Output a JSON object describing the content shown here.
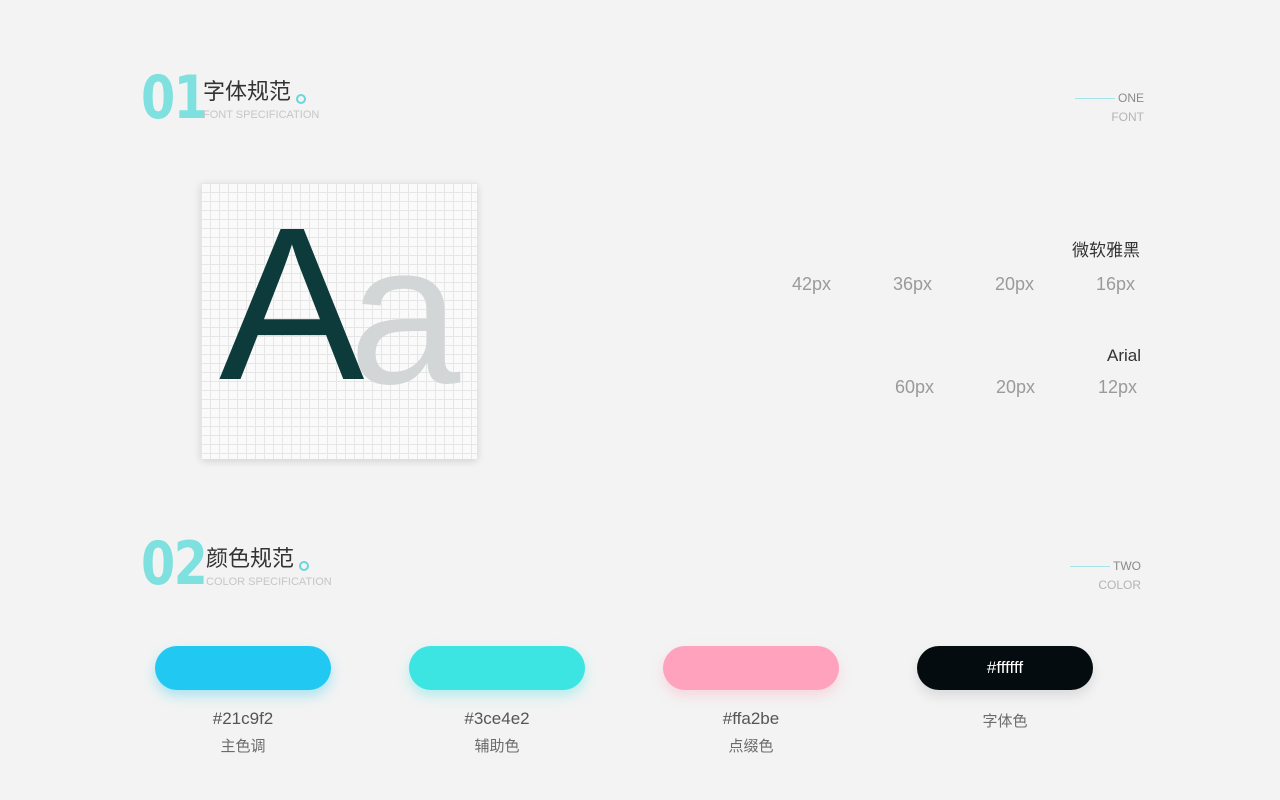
{
  "section1": {
    "number": "01",
    "title": "字体规范",
    "subtitle": "FONT SPECIFICATION",
    "tag_top": "ONE",
    "tag_bottom": "FONT"
  },
  "specimen": {
    "upper": "A",
    "lower": "a"
  },
  "fonts": [
    {
      "name": "微软雅黑",
      "sizes": [
        "42px",
        "36px",
        "20px",
        "16px"
      ]
    },
    {
      "name": "Arial",
      "sizes": [
        "60px",
        "20px",
        "12px"
      ]
    }
  ],
  "section2": {
    "number": "02",
    "title": "颜色规范",
    "subtitle": "COLOR SPECIFICATION",
    "tag_top": "TWO",
    "tag_bottom": "COLOR"
  },
  "colors": [
    {
      "hex": "#21c9f2",
      "name": "主色调",
      "label": "",
      "swatch": "#21c9f2",
      "shadow": "rgba(33,201,242,0.35)"
    },
    {
      "hex": "#3ce4e2",
      "name": "辅助色",
      "label": "",
      "swatch": "#3ce4e2",
      "shadow": "rgba(60,228,226,0.35)"
    },
    {
      "hex": "#ffa2be",
      "name": "点缀色",
      "label": "",
      "swatch": "#ffa2be",
      "shadow": "rgba(255,162,190,0.35)"
    },
    {
      "hex": "",
      "name": "字体色",
      "label": "#ffffff",
      "swatch": "#050c0f",
      "shadow": "rgba(0,0,0,0.1)"
    }
  ],
  "theme": {
    "background": "#f3f3f3",
    "accent": "#7fe0e0",
    "glyph_dark": "#0d3a3a",
    "glyph_light": "#d3d6d7"
  }
}
